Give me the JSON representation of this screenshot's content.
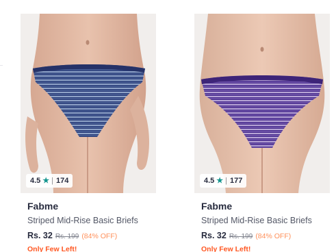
{
  "products": [
    {
      "brand": "Fabme",
      "name": "Striped Mid-Rise Basic Briefs",
      "rating": "4.5",
      "rating_separator": "|",
      "rating_count": "174",
      "price": "Rs. 32",
      "mrp": "Rs. 199",
      "discount": "(84% OFF)",
      "stock_note": "Only Few Left!",
      "image_main_color": "#2c3e7a",
      "image_stripe_color": "#8fa4c8"
    },
    {
      "brand": "Fabme",
      "name": "Striped Mid-Rise Basic Briefs",
      "rating": "4.5",
      "rating_separator": "|",
      "rating_count": "177",
      "price": "Rs. 32",
      "mrp": "Rs. 199",
      "discount": "(84% OFF)",
      "stock_note": "Only Few Left!",
      "image_main_color": "#4a2f8e",
      "image_stripe_color": "#b7a5d6"
    }
  ],
  "icons": {
    "rating_star": "star-icon"
  },
  "colors": {
    "rating_star": "#14958f",
    "discount": "#ff905a",
    "stock_alert": "#ff5722",
    "text_primary": "#282c3f",
    "text_secondary": "#535766"
  }
}
